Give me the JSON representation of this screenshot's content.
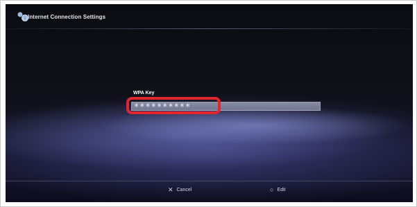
{
  "window": {
    "title": "Internet Connection Settings",
    "title_icon": "network-globe-icon"
  },
  "field": {
    "label": "WPA Key",
    "value": "**********"
  },
  "actions": {
    "cancel": {
      "glyph": "✕",
      "label": "Cancel",
      "icon": "cross-button-icon"
    },
    "edit": {
      "glyph": "○",
      "label": "Edit",
      "icon": "circle-button-icon"
    }
  },
  "colors": {
    "highlight": "#e3262d",
    "background": "#101019",
    "wave": "#6f78c6"
  }
}
